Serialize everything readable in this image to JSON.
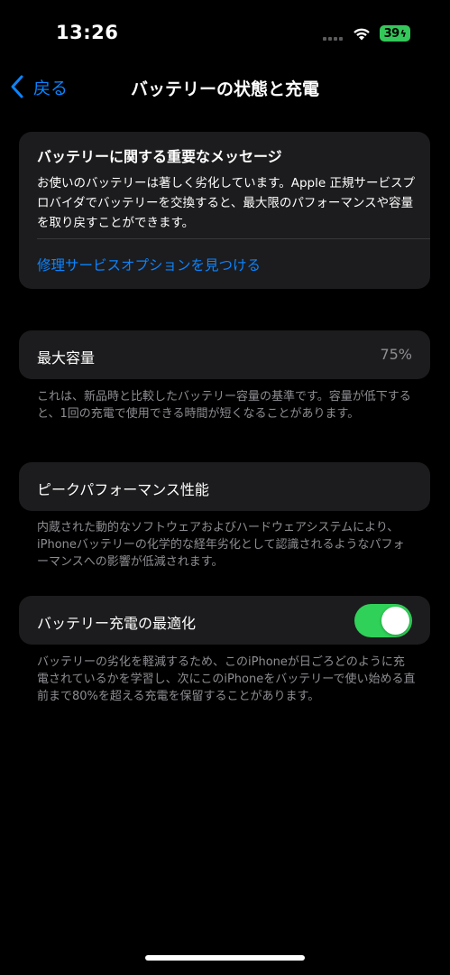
{
  "status_bar": {
    "time": "13:26",
    "battery_level": "39",
    "battery_color": "#34c759",
    "icons": [
      "signal-icon",
      "wifi-icon",
      "battery-icon"
    ]
  },
  "nav": {
    "back_label": "戻る",
    "title": "バッテリーの状態と充電"
  },
  "message_card": {
    "title": "バッテリーに関する重要なメッセージ",
    "body": "お使いのバッテリーは著しく劣化しています。Apple 正規サービスプロバイダでバッテリーを交換すると、最大限のパフォーマンスや容量を取り戻すことができます。",
    "link": "修理サービスオプションを見つける"
  },
  "max_capacity": {
    "label": "最大容量",
    "value": "75%",
    "footnote": "これは、新品時と比較したバッテリー容量の基準です。容量が低下すると、1回の充電で使用できる時間が短くなることがあります。"
  },
  "peak_performance": {
    "label": "ピークパフォーマンス性能",
    "footnote": "内蔵された動的なソフトウェアおよびハードウェアシステムにより、iPhoneバッテリーの化学的な経年劣化として認識されるようなパフォーマンスへの影響が低減されます。"
  },
  "optimized_charging": {
    "label": "バッテリー充電の最適化",
    "enabled": true,
    "toggle_color": "#30d158",
    "footnote": "バッテリーの劣化を軽減するため、このiPhoneが日ごろどのように充電されているかを学習し、次にこのiPhoneをバッテリーで使い始める直前まで80%を超える充電を保留することがあります。"
  },
  "colors": {
    "accent": "#0a84ff",
    "card_bg": "#1c1c1e",
    "secondary_text": "#8e8e93"
  }
}
